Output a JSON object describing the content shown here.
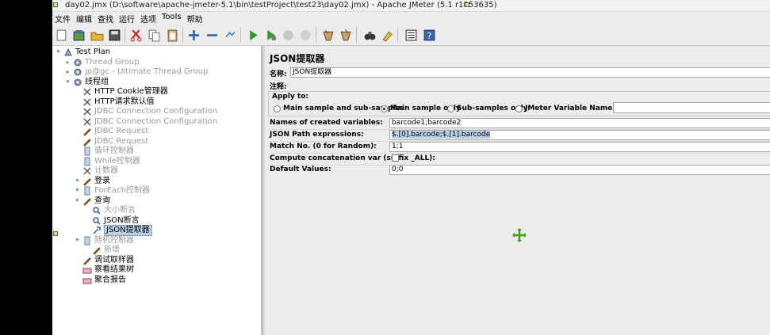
{
  "window": {
    "title": "day02.jmx (D:\\software\\apache-jmeter-5.1\\bin\\testProject\\test23\\day02.jmx) - Apache JMeter (5.1 r1853635)"
  },
  "menubar": {
    "items": [
      "文件",
      "编辑",
      "查找",
      "运行",
      "选项",
      "Tools",
      "帮助"
    ]
  },
  "toolbar": {
    "icons": [
      "new-icon",
      "templates-icon",
      "open-icon",
      "save-icon",
      "cut-icon",
      "copy-icon",
      "paste-icon",
      "expand-icon",
      "collapse-icon",
      "toggle-icon",
      "start-icon",
      "start-no-pause-icon",
      "stop-icon",
      "shutdown-icon",
      "clear-icon",
      "clear-all-icon",
      "search-icon",
      "reset-search-icon",
      "function-helper-icon",
      "help-icon"
    ]
  },
  "tree": {
    "nodes": [
      {
        "label": "Test Plan",
        "icon": "test-plan-icon",
        "disabled": false
      },
      {
        "label": "Thread Group",
        "icon": "gear-icon",
        "disabled": true
      },
      {
        "label": "jp@gc - Ultimate Thread Group",
        "icon": "gear-icon",
        "disabled": true
      },
      {
        "label": "线程组",
        "icon": "gear-icon",
        "disabled": false
      },
      {
        "label": "HTTP Cookie管理器",
        "icon": "config-icon",
        "disabled": false
      },
      {
        "label": "HTTP请求默认值",
        "icon": "config-icon",
        "disabled": false
      },
      {
        "label": "JDBC Connection Configuration",
        "icon": "config-icon",
        "disabled": true
      },
      {
        "label": "JDBC Connection Configuration",
        "icon": "config-icon",
        "disabled": true
      },
      {
        "label": "JDBC Request",
        "icon": "sampler-icon",
        "disabled": true
      },
      {
        "label": "JDBC Request",
        "icon": "sampler-icon",
        "disabled": true
      },
      {
        "label": "循环控制器",
        "icon": "controller-icon",
        "disabled": true
      },
      {
        "label": "While控制器",
        "icon": "controller-icon",
        "disabled": true
      },
      {
        "label": "计数器",
        "icon": "config-icon",
        "disabled": true
      },
      {
        "label": "登录",
        "icon": "sampler-icon",
        "disabled": false
      },
      {
        "label": "ForEach控制器",
        "icon": "controller-icon",
        "disabled": true
      },
      {
        "label": "查询",
        "icon": "sampler-icon",
        "disabled": false
      },
      {
        "label": "大小断言",
        "icon": "assertion-icon",
        "disabled": true
      },
      {
        "label": "JSON断言",
        "icon": "assertion-icon",
        "disabled": false
      },
      {
        "label": "JSON提取器",
        "icon": "extractor-icon",
        "disabled": false
      },
      {
        "label": "随机控制器",
        "icon": "controller-icon",
        "disabled": true
      },
      {
        "label": "新增",
        "icon": "sampler-icon",
        "disabled": true
      },
      {
        "label": "调试取样器",
        "icon": "sampler-icon",
        "disabled": false
      },
      {
        "label": "察看结果树",
        "icon": "listener-icon",
        "disabled": false
      },
      {
        "label": "聚合报告",
        "icon": "listener-icon",
        "disabled": false
      }
    ]
  },
  "panel": {
    "title": "JSON提取器",
    "name_label": "名称:",
    "name_value": "JSON提取器",
    "comment_label": "注释:",
    "comment_value": "",
    "apply_to": {
      "title": "Apply to:",
      "options": [
        {
          "label": "Main sample and sub-samples",
          "selected": false
        },
        {
          "label": "Main sample only",
          "selected": true
        },
        {
          "label": "Sub-samples only",
          "selected": false
        },
        {
          "label": "JMeter Variable Name to use",
          "selected": false
        }
      ],
      "variable_value": ""
    },
    "fields": [
      {
        "label": "Names of created variables:",
        "value": "barcode1;barcode2"
      },
      {
        "label": "JSON Path expressions:",
        "value": "$.[0].barcode;$.[1].barcode"
      },
      {
        "label": "Match No. (0 for Random):",
        "value": "1;1"
      },
      {
        "label": "Compute concatenation var (suffix _ALL):",
        "value": ""
      },
      {
        "label": "Default Values:",
        "value": "0;0"
      }
    ],
    "concatenation_checked": false
  },
  "colors": {
    "selection": "#b8cfe5",
    "run_green": "#2e9b2e",
    "disabled_text": "#9a9a9a"
  }
}
